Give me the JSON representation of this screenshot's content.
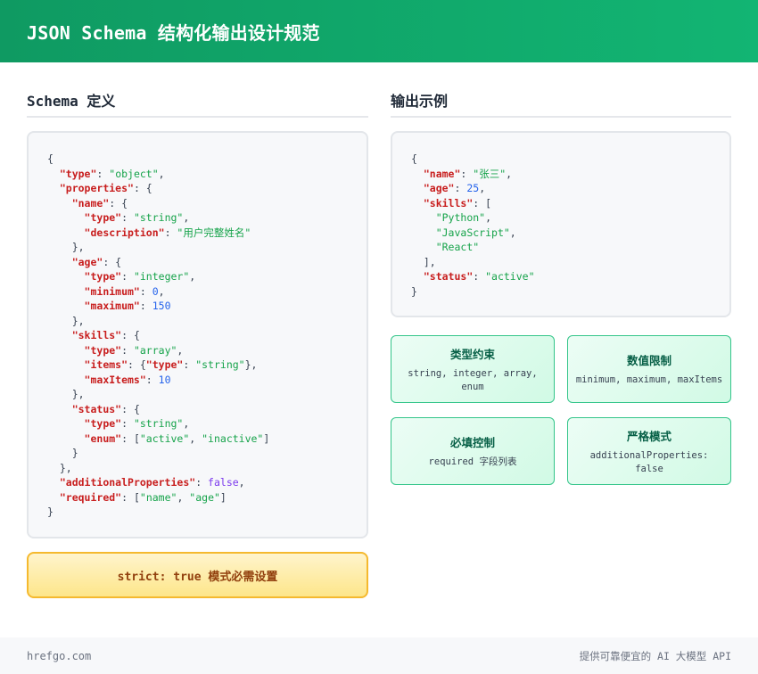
{
  "header": {
    "title": "JSON Schema 结构化输出设计规范"
  },
  "schema_section": {
    "title": "Schema 定义",
    "code_lines": [
      [
        {
          "t": "p",
          "v": "{"
        }
      ],
      [
        {
          "t": "p",
          "v": "  "
        },
        {
          "t": "k",
          "v": "\"type\""
        },
        {
          "t": "p",
          "v": ": "
        },
        {
          "t": "s",
          "v": "\"object\""
        },
        {
          "t": "p",
          "v": ","
        }
      ],
      [
        {
          "t": "p",
          "v": "  "
        },
        {
          "t": "k",
          "v": "\"properties\""
        },
        {
          "t": "p",
          "v": ": {"
        }
      ],
      [
        {
          "t": "p",
          "v": "    "
        },
        {
          "t": "k",
          "v": "\"name\""
        },
        {
          "t": "p",
          "v": ": {"
        }
      ],
      [
        {
          "t": "p",
          "v": "      "
        },
        {
          "t": "k",
          "v": "\"type\""
        },
        {
          "t": "p",
          "v": ": "
        },
        {
          "t": "s",
          "v": "\"string\""
        },
        {
          "t": "p",
          "v": ","
        }
      ],
      [
        {
          "t": "p",
          "v": "      "
        },
        {
          "t": "k",
          "v": "\"description\""
        },
        {
          "t": "p",
          "v": ": "
        },
        {
          "t": "s",
          "v": "\"用户完整姓名\""
        }
      ],
      [
        {
          "t": "p",
          "v": "    },"
        }
      ],
      [
        {
          "t": "p",
          "v": "    "
        },
        {
          "t": "k",
          "v": "\"age\""
        },
        {
          "t": "p",
          "v": ": {"
        }
      ],
      [
        {
          "t": "p",
          "v": "      "
        },
        {
          "t": "k",
          "v": "\"type\""
        },
        {
          "t": "p",
          "v": ": "
        },
        {
          "t": "s",
          "v": "\"integer\""
        },
        {
          "t": "p",
          "v": ","
        }
      ],
      [
        {
          "t": "p",
          "v": "      "
        },
        {
          "t": "k",
          "v": "\"minimum\""
        },
        {
          "t": "p",
          "v": ": "
        },
        {
          "t": "n",
          "v": "0"
        },
        {
          "t": "p",
          "v": ","
        }
      ],
      [
        {
          "t": "p",
          "v": "      "
        },
        {
          "t": "k",
          "v": "\"maximum\""
        },
        {
          "t": "p",
          "v": ": "
        },
        {
          "t": "n",
          "v": "150"
        }
      ],
      [
        {
          "t": "p",
          "v": "    },"
        }
      ],
      [
        {
          "t": "p",
          "v": "    "
        },
        {
          "t": "k",
          "v": "\"skills\""
        },
        {
          "t": "p",
          "v": ": {"
        }
      ],
      [
        {
          "t": "p",
          "v": "      "
        },
        {
          "t": "k",
          "v": "\"type\""
        },
        {
          "t": "p",
          "v": ": "
        },
        {
          "t": "s",
          "v": "\"array\""
        },
        {
          "t": "p",
          "v": ","
        }
      ],
      [
        {
          "t": "p",
          "v": "      "
        },
        {
          "t": "k",
          "v": "\"items\""
        },
        {
          "t": "p",
          "v": ": {"
        },
        {
          "t": "k",
          "v": "\"type\""
        },
        {
          "t": "p",
          "v": ": "
        },
        {
          "t": "s",
          "v": "\"string\""
        },
        {
          "t": "p",
          "v": "},"
        }
      ],
      [
        {
          "t": "p",
          "v": "      "
        },
        {
          "t": "k",
          "v": "\"maxItems\""
        },
        {
          "t": "p",
          "v": ": "
        },
        {
          "t": "n",
          "v": "10"
        }
      ],
      [
        {
          "t": "p",
          "v": "    },"
        }
      ],
      [
        {
          "t": "p",
          "v": "    "
        },
        {
          "t": "k",
          "v": "\"status\""
        },
        {
          "t": "p",
          "v": ": {"
        }
      ],
      [
        {
          "t": "p",
          "v": "      "
        },
        {
          "t": "k",
          "v": "\"type\""
        },
        {
          "t": "p",
          "v": ": "
        },
        {
          "t": "s",
          "v": "\"string\""
        },
        {
          "t": "p",
          "v": ","
        }
      ],
      [
        {
          "t": "p",
          "v": "      "
        },
        {
          "t": "k",
          "v": "\"enum\""
        },
        {
          "t": "p",
          "v": ": ["
        },
        {
          "t": "s",
          "v": "\"active\""
        },
        {
          "t": "p",
          "v": ", "
        },
        {
          "t": "s",
          "v": "\"inactive\""
        },
        {
          "t": "p",
          "v": "]"
        }
      ],
      [
        {
          "t": "p",
          "v": "    }"
        }
      ],
      [
        {
          "t": "p",
          "v": "  },"
        }
      ],
      [
        {
          "t": "p",
          "v": "  "
        },
        {
          "t": "k",
          "v": "\"additionalProperties\""
        },
        {
          "t": "p",
          "v": ": "
        },
        {
          "t": "b",
          "v": "false"
        },
        {
          "t": "p",
          "v": ","
        }
      ],
      [
        {
          "t": "p",
          "v": "  "
        },
        {
          "t": "k",
          "v": "\"required\""
        },
        {
          "t": "p",
          "v": ": ["
        },
        {
          "t": "s",
          "v": "\"name\""
        },
        {
          "t": "p",
          "v": ", "
        },
        {
          "t": "s",
          "v": "\"age\""
        },
        {
          "t": "p",
          "v": "]"
        }
      ],
      [
        {
          "t": "p",
          "v": "}"
        }
      ]
    ]
  },
  "strict_note": "strict: true 模式必需设置",
  "example_section": {
    "title": "输出示例",
    "code_lines": [
      [
        {
          "t": "p",
          "v": "{"
        }
      ],
      [
        {
          "t": "p",
          "v": "  "
        },
        {
          "t": "k",
          "v": "\"name\""
        },
        {
          "t": "p",
          "v": ": "
        },
        {
          "t": "s",
          "v": "\"张三\""
        },
        {
          "t": "p",
          "v": ","
        }
      ],
      [
        {
          "t": "p",
          "v": "  "
        },
        {
          "t": "k",
          "v": "\"age\""
        },
        {
          "t": "p",
          "v": ": "
        },
        {
          "t": "n",
          "v": "25"
        },
        {
          "t": "p",
          "v": ","
        }
      ],
      [
        {
          "t": "p",
          "v": "  "
        },
        {
          "t": "k",
          "v": "\"skills\""
        },
        {
          "t": "p",
          "v": ": ["
        }
      ],
      [
        {
          "t": "p",
          "v": "    "
        },
        {
          "t": "s",
          "v": "\"Python\""
        },
        {
          "t": "p",
          "v": ","
        }
      ],
      [
        {
          "t": "p",
          "v": "    "
        },
        {
          "t": "s",
          "v": "\"JavaScript\""
        },
        {
          "t": "p",
          "v": ","
        }
      ],
      [
        {
          "t": "p",
          "v": "    "
        },
        {
          "t": "s",
          "v": "\"React\""
        }
      ],
      [
        {
          "t": "p",
          "v": "  ],"
        }
      ],
      [
        {
          "t": "p",
          "v": "  "
        },
        {
          "t": "k",
          "v": "\"status\""
        },
        {
          "t": "p",
          "v": ": "
        },
        {
          "t": "s",
          "v": "\"active\""
        }
      ],
      [
        {
          "t": "p",
          "v": "}"
        }
      ]
    ]
  },
  "cards": [
    {
      "title": "类型约束",
      "desc": "string, integer, array, enum"
    },
    {
      "title": "数值限制",
      "desc": "minimum, maximum, maxItems"
    },
    {
      "title": "必填控制",
      "desc": "required 字段列表"
    },
    {
      "title": "严格模式",
      "desc": "additionalProperties: false"
    }
  ],
  "footer": {
    "left": "hrefgo.com",
    "right": "提供可靠便宜的 AI 大模型 API"
  },
  "colors": {
    "header_start": "#0f9a62",
    "header_end": "#12b573",
    "code_key": "#c81e1e",
    "code_string": "#16a34a",
    "code_number": "#2563eb",
    "code_boolean": "#7c3aed",
    "strict_border": "#f5b92e",
    "card_border": "#34c58a"
  }
}
